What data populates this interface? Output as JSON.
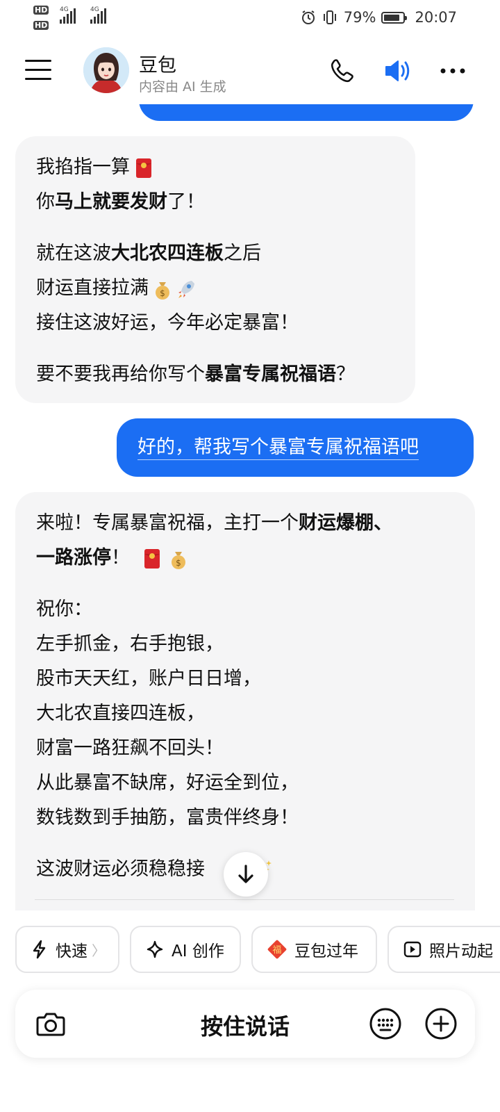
{
  "status_bar": {
    "hd1": "HD",
    "hd2": "HD",
    "network1": "4G",
    "network2": "4G",
    "battery": "79%",
    "time": "20:07"
  },
  "header": {
    "title": "豆包",
    "subtitle": "内容由 AI 生成",
    "icons": [
      "menu-icon",
      "phone-icon",
      "speaker-icon",
      "more-icon"
    ]
  },
  "messages": {
    "ai1": {
      "l1": "我掐指一算",
      "l2a": "你",
      "l2b": "马上就要发财",
      "l2c": "了！",
      "l3a": "就在这波",
      "l3b": "大北农四连板",
      "l3c": "之后",
      "l4": "财运直接拉满",
      "l5": "接住这波好运，今年必定暴富！",
      "l6a": "要不要我再给你写个",
      "l6b": "暴富专属祝福语",
      "l6c": "？"
    },
    "user1": "好的，帮我写个暴富专属祝福语吧",
    "ai2": {
      "l1a": "来啦！专属暴富祝福，主打一个",
      "l1b": "财运爆棚、",
      "l2a": "一路涨停",
      "l2b": "！",
      "l3": "祝你：",
      "l4": "左手抓金，右手抱银，",
      "l5": "股市天天红，账户日日增，",
      "l6": "大北农直接四连板，",
      "l7": "财富一路狂飙不回头！",
      "l8": "从此暴富不缺席，好运全到位，",
      "l9": "数钱数到手抽筋，富贵伴终身！",
      "l10": "这波财运必须稳稳接"
    }
  },
  "chips": [
    {
      "label": "快速",
      "icon": "lightning-icon"
    },
    {
      "label": "AI 创作",
      "icon": "sparkle-icon"
    },
    {
      "label": "豆包过年",
      "icon": "fu-icon"
    },
    {
      "label": "照片动起",
      "icon": "play-icon"
    }
  ],
  "input_bar": {
    "talk_label": "按住说话",
    "icons": [
      "camera-icon",
      "keyboard-icon",
      "plus-icon"
    ]
  },
  "colors": {
    "accent": "#1b6ef3",
    "bubble_ai": "#f5f5f6"
  }
}
